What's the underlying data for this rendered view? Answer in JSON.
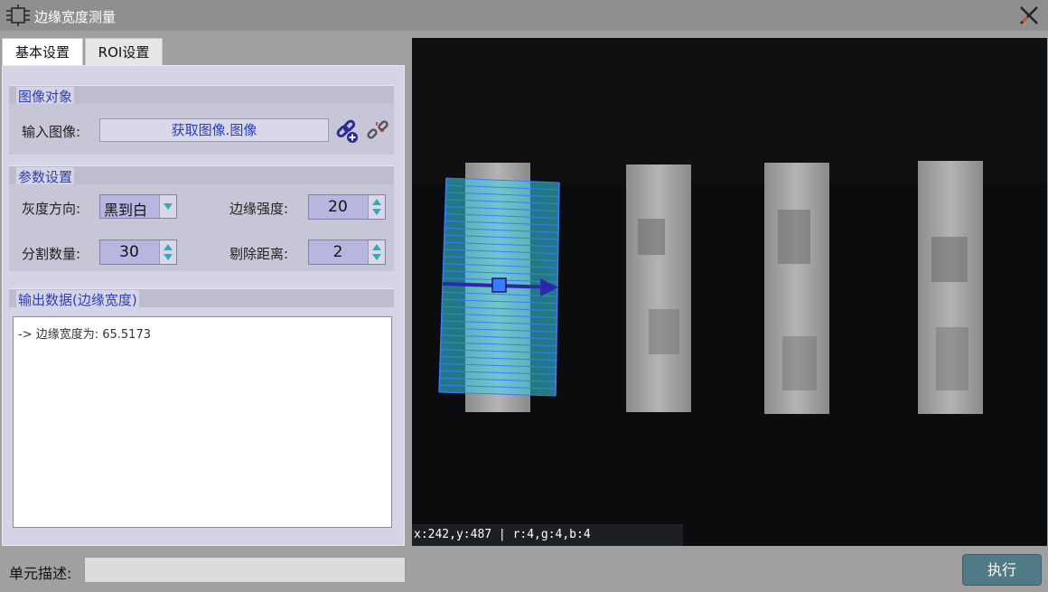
{
  "window": {
    "title": "边缘宽度测量"
  },
  "tabs": [
    {
      "label": "基本设置",
      "active": true
    },
    {
      "label": "ROI设置",
      "active": false
    }
  ],
  "image_group": {
    "title": "图像对象",
    "input_label": "输入图像:",
    "input_value": "获取图像.图像"
  },
  "params_group": {
    "title": "参数设置",
    "gray_direction_label": "灰度方向:",
    "gray_direction_value": "黑到白",
    "edge_strength_label": "边缘强度:",
    "edge_strength_value": "20",
    "split_count_label": "分割数量:",
    "split_count_value": "30",
    "remove_distance_label": "剔除距离:",
    "remove_distance_value": "2"
  },
  "output_group": {
    "title": "输出数据(边缘宽度)",
    "lines": [
      "-> 边缘宽度为: 65.5173"
    ]
  },
  "viewer": {
    "coord_text": "x:242,y:487 | r:4,g:4,b:4"
  },
  "footer": {
    "desc_label": "单元描述:",
    "desc_value": "",
    "exec_label": "执行"
  },
  "colors": {
    "accent": "#2c3fb3",
    "exec_button": "#507a86",
    "roi_blue": "#3a7bff",
    "roi_fill": "#39d3e6"
  }
}
